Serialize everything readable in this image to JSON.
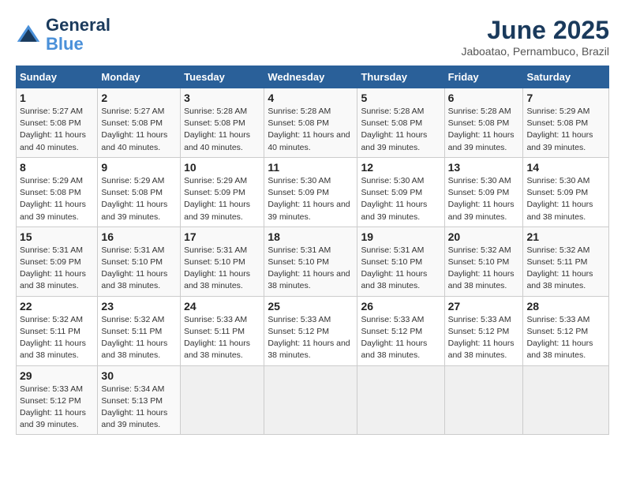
{
  "logo": {
    "line1": "General",
    "line2": "Blue"
  },
  "title": "June 2025",
  "subtitle": "Jaboatao, Pernambuco, Brazil",
  "headers": [
    "Sunday",
    "Monday",
    "Tuesday",
    "Wednesday",
    "Thursday",
    "Friday",
    "Saturday"
  ],
  "weeks": [
    [
      {
        "day": "1",
        "sunrise": "Sunrise: 5:27 AM",
        "sunset": "Sunset: 5:08 PM",
        "daylight": "Daylight: 11 hours and 40 minutes."
      },
      {
        "day": "2",
        "sunrise": "Sunrise: 5:27 AM",
        "sunset": "Sunset: 5:08 PM",
        "daylight": "Daylight: 11 hours and 40 minutes."
      },
      {
        "day": "3",
        "sunrise": "Sunrise: 5:28 AM",
        "sunset": "Sunset: 5:08 PM",
        "daylight": "Daylight: 11 hours and 40 minutes."
      },
      {
        "day": "4",
        "sunrise": "Sunrise: 5:28 AM",
        "sunset": "Sunset: 5:08 PM",
        "daylight": "Daylight: 11 hours and 40 minutes."
      },
      {
        "day": "5",
        "sunrise": "Sunrise: 5:28 AM",
        "sunset": "Sunset: 5:08 PM",
        "daylight": "Daylight: 11 hours and 39 minutes."
      },
      {
        "day": "6",
        "sunrise": "Sunrise: 5:28 AM",
        "sunset": "Sunset: 5:08 PM",
        "daylight": "Daylight: 11 hours and 39 minutes."
      },
      {
        "day": "7",
        "sunrise": "Sunrise: 5:29 AM",
        "sunset": "Sunset: 5:08 PM",
        "daylight": "Daylight: 11 hours and 39 minutes."
      }
    ],
    [
      {
        "day": "8",
        "sunrise": "Sunrise: 5:29 AM",
        "sunset": "Sunset: 5:08 PM",
        "daylight": "Daylight: 11 hours and 39 minutes."
      },
      {
        "day": "9",
        "sunrise": "Sunrise: 5:29 AM",
        "sunset": "Sunset: 5:08 PM",
        "daylight": "Daylight: 11 hours and 39 minutes."
      },
      {
        "day": "10",
        "sunrise": "Sunrise: 5:29 AM",
        "sunset": "Sunset: 5:09 PM",
        "daylight": "Daylight: 11 hours and 39 minutes."
      },
      {
        "day": "11",
        "sunrise": "Sunrise: 5:30 AM",
        "sunset": "Sunset: 5:09 PM",
        "daylight": "Daylight: 11 hours and 39 minutes."
      },
      {
        "day": "12",
        "sunrise": "Sunrise: 5:30 AM",
        "sunset": "Sunset: 5:09 PM",
        "daylight": "Daylight: 11 hours and 39 minutes."
      },
      {
        "day": "13",
        "sunrise": "Sunrise: 5:30 AM",
        "sunset": "Sunset: 5:09 PM",
        "daylight": "Daylight: 11 hours and 39 minutes."
      },
      {
        "day": "14",
        "sunrise": "Sunrise: 5:30 AM",
        "sunset": "Sunset: 5:09 PM",
        "daylight": "Daylight: 11 hours and 38 minutes."
      }
    ],
    [
      {
        "day": "15",
        "sunrise": "Sunrise: 5:31 AM",
        "sunset": "Sunset: 5:09 PM",
        "daylight": "Daylight: 11 hours and 38 minutes."
      },
      {
        "day": "16",
        "sunrise": "Sunrise: 5:31 AM",
        "sunset": "Sunset: 5:10 PM",
        "daylight": "Daylight: 11 hours and 38 minutes."
      },
      {
        "day": "17",
        "sunrise": "Sunrise: 5:31 AM",
        "sunset": "Sunset: 5:10 PM",
        "daylight": "Daylight: 11 hours and 38 minutes."
      },
      {
        "day": "18",
        "sunrise": "Sunrise: 5:31 AM",
        "sunset": "Sunset: 5:10 PM",
        "daylight": "Daylight: 11 hours and 38 minutes."
      },
      {
        "day": "19",
        "sunrise": "Sunrise: 5:31 AM",
        "sunset": "Sunset: 5:10 PM",
        "daylight": "Daylight: 11 hours and 38 minutes."
      },
      {
        "day": "20",
        "sunrise": "Sunrise: 5:32 AM",
        "sunset": "Sunset: 5:10 PM",
        "daylight": "Daylight: 11 hours and 38 minutes."
      },
      {
        "day": "21",
        "sunrise": "Sunrise: 5:32 AM",
        "sunset": "Sunset: 5:11 PM",
        "daylight": "Daylight: 11 hours and 38 minutes."
      }
    ],
    [
      {
        "day": "22",
        "sunrise": "Sunrise: 5:32 AM",
        "sunset": "Sunset: 5:11 PM",
        "daylight": "Daylight: 11 hours and 38 minutes."
      },
      {
        "day": "23",
        "sunrise": "Sunrise: 5:32 AM",
        "sunset": "Sunset: 5:11 PM",
        "daylight": "Daylight: 11 hours and 38 minutes."
      },
      {
        "day": "24",
        "sunrise": "Sunrise: 5:33 AM",
        "sunset": "Sunset: 5:11 PM",
        "daylight": "Daylight: 11 hours and 38 minutes."
      },
      {
        "day": "25",
        "sunrise": "Sunrise: 5:33 AM",
        "sunset": "Sunset: 5:12 PM",
        "daylight": "Daylight: 11 hours and 38 minutes."
      },
      {
        "day": "26",
        "sunrise": "Sunrise: 5:33 AM",
        "sunset": "Sunset: 5:12 PM",
        "daylight": "Daylight: 11 hours and 38 minutes."
      },
      {
        "day": "27",
        "sunrise": "Sunrise: 5:33 AM",
        "sunset": "Sunset: 5:12 PM",
        "daylight": "Daylight: 11 hours and 38 minutes."
      },
      {
        "day": "28",
        "sunrise": "Sunrise: 5:33 AM",
        "sunset": "Sunset: 5:12 PM",
        "daylight": "Daylight: 11 hours and 38 minutes."
      }
    ],
    [
      {
        "day": "29",
        "sunrise": "Sunrise: 5:33 AM",
        "sunset": "Sunset: 5:12 PM",
        "daylight": "Daylight: 11 hours and 39 minutes."
      },
      {
        "day": "30",
        "sunrise": "Sunrise: 5:34 AM",
        "sunset": "Sunset: 5:13 PM",
        "daylight": "Daylight: 11 hours and 39 minutes."
      },
      null,
      null,
      null,
      null,
      null
    ]
  ]
}
